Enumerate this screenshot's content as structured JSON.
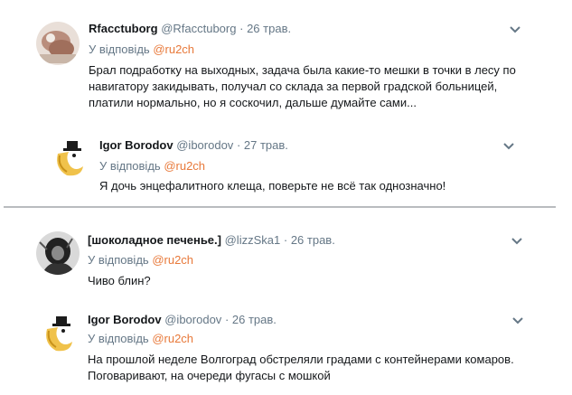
{
  "tweets": [
    {
      "name": "Rfacctuborg",
      "handle": "@Rfacctuborg",
      "date": "26 трав.",
      "reply_prefix": "У відповідь",
      "reply_to": "@ru2ch",
      "text": "Брал подработку на выходных, задача была какие-то мешки в точки в лесу по навигатору закидывать, получал со склада за первой градской больницей, платили нормально, но я соскочил, дальше думайте сами..."
    },
    {
      "name": "Igor Borodov",
      "handle": "@iborodov",
      "date": "27 трав.",
      "reply_prefix": "У відповідь",
      "reply_to": "@ru2ch",
      "text": "Я дочь энцефалитного клеща, поверьте не всё так однозначно!"
    },
    {
      "name": "[шоколадное печенье.]",
      "handle": "@lizzSka1",
      "date": "26 трав.",
      "reply_prefix": "У відповідь",
      "reply_to": "@ru2ch",
      "text": "Чиво блин?"
    },
    {
      "name": "Igor Borodov",
      "handle": "@iborodov",
      "date": "26 трав.",
      "reply_prefix": "У відповідь",
      "reply_to": "@ru2ch",
      "text": "На прошлой неделе Волгоград обстреляли градами с контейнерами комаров. Поговаривают, на очереди фугасы с мошкой"
    }
  ],
  "colors": {
    "mention": "#e8793a",
    "secondary_text": "#657786",
    "divider": "#b9bcbf"
  },
  "icons": {
    "menu": "chevron-down-icon"
  }
}
